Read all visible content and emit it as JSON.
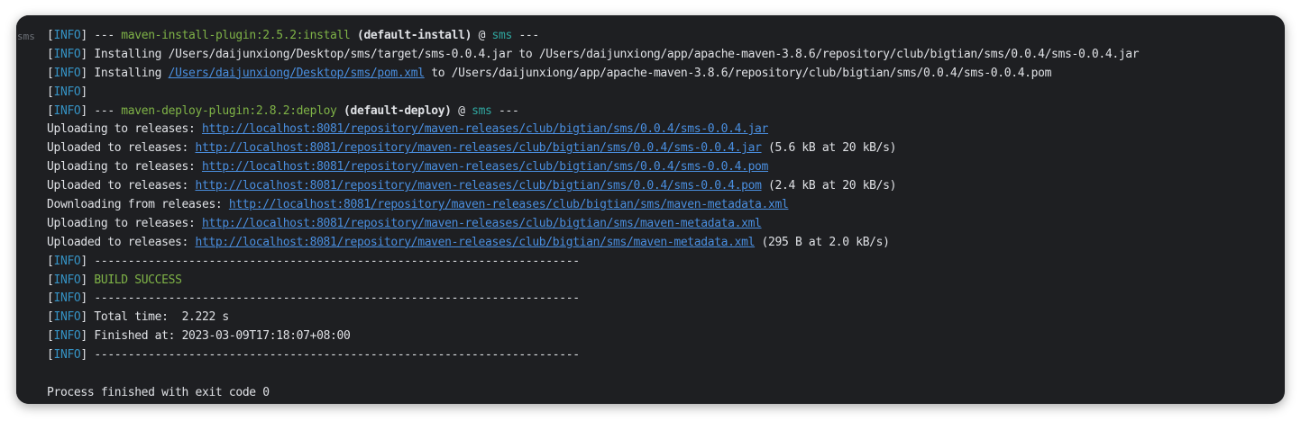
{
  "gutter": {
    "label": "sms"
  },
  "info_tag": "INFO",
  "lines": {
    "l1": {
      "prefix": " --- ",
      "plugin": "maven-install-plugin:2.5.2:install",
      "goal": " (default-install)",
      "at": " @ ",
      "artifact": "sms",
      "suffix": " ---"
    },
    "l2": {
      "text": " Installing /Users/daijunxiong/Desktop/sms/target/sms-0.0.4.jar to /Users/daijunxiong/app/apache-maven-3.8.6/repository/club/bigtian/sms/0.0.4/sms-0.0.4.jar"
    },
    "l3": {
      "prefix": " Installing ",
      "link": "/Users/daijunxiong/Desktop/sms/pom.xml",
      "suffix": " to /Users/daijunxiong/app/apache-maven-3.8.6/repository/club/bigtian/sms/0.0.4/sms-0.0.4.pom"
    },
    "l5": {
      "prefix": " --- ",
      "plugin": "maven-deploy-plugin:2.8.2:deploy",
      "goal": " (default-deploy)",
      "at": " @ ",
      "artifact": "sms",
      "suffix": " ---"
    },
    "l6": {
      "prefix": "Uploading to releases: ",
      "link": "http://localhost:8081/repository/maven-releases/club/bigtian/sms/0.0.4/sms-0.0.4.jar"
    },
    "l7": {
      "prefix": "Uploaded to releases: ",
      "link": "http://localhost:8081/repository/maven-releases/club/bigtian/sms/0.0.4/sms-0.0.4.jar",
      "suffix": " (5.6 kB at 20 kB/s)"
    },
    "l8": {
      "prefix": "Uploading to releases: ",
      "link": "http://localhost:8081/repository/maven-releases/club/bigtian/sms/0.0.4/sms-0.0.4.pom"
    },
    "l9": {
      "prefix": "Uploaded to releases: ",
      "link": "http://localhost:8081/repository/maven-releases/club/bigtian/sms/0.0.4/sms-0.0.4.pom",
      "suffix": " (2.4 kB at 20 kB/s)"
    },
    "l10": {
      "prefix": "Downloading from releases: ",
      "link": "http://localhost:8081/repository/maven-releases/club/bigtian/sms/maven-metadata.xml"
    },
    "l11": {
      "prefix": "Uploading to releases: ",
      "link": "http://localhost:8081/repository/maven-releases/club/bigtian/sms/maven-metadata.xml"
    },
    "l12": {
      "prefix": "Uploaded to releases: ",
      "link": "http://localhost:8081/repository/maven-releases/club/bigtian/sms/maven-metadata.xml",
      "suffix": " (295 B at 2.0 kB/s)"
    },
    "l13": {
      "text": " ------------------------------------------------------------------------"
    },
    "l14": {
      "text": " BUILD SUCCESS"
    },
    "l15": {
      "text": " ------------------------------------------------------------------------"
    },
    "l16": {
      "text": " Total time:  2.222 s"
    },
    "l17": {
      "text": " Finished at: 2023-03-09T17:18:07+08:00"
    },
    "l18": {
      "text": " ------------------------------------------------------------------------"
    },
    "l20": {
      "text": "Process finished with exit code 0"
    }
  },
  "colors": {
    "background": "#1e1f22",
    "info": "#3592c4",
    "link": "#4a8fe0",
    "success": "#7fb347",
    "artifact": "#2fa7a0"
  }
}
